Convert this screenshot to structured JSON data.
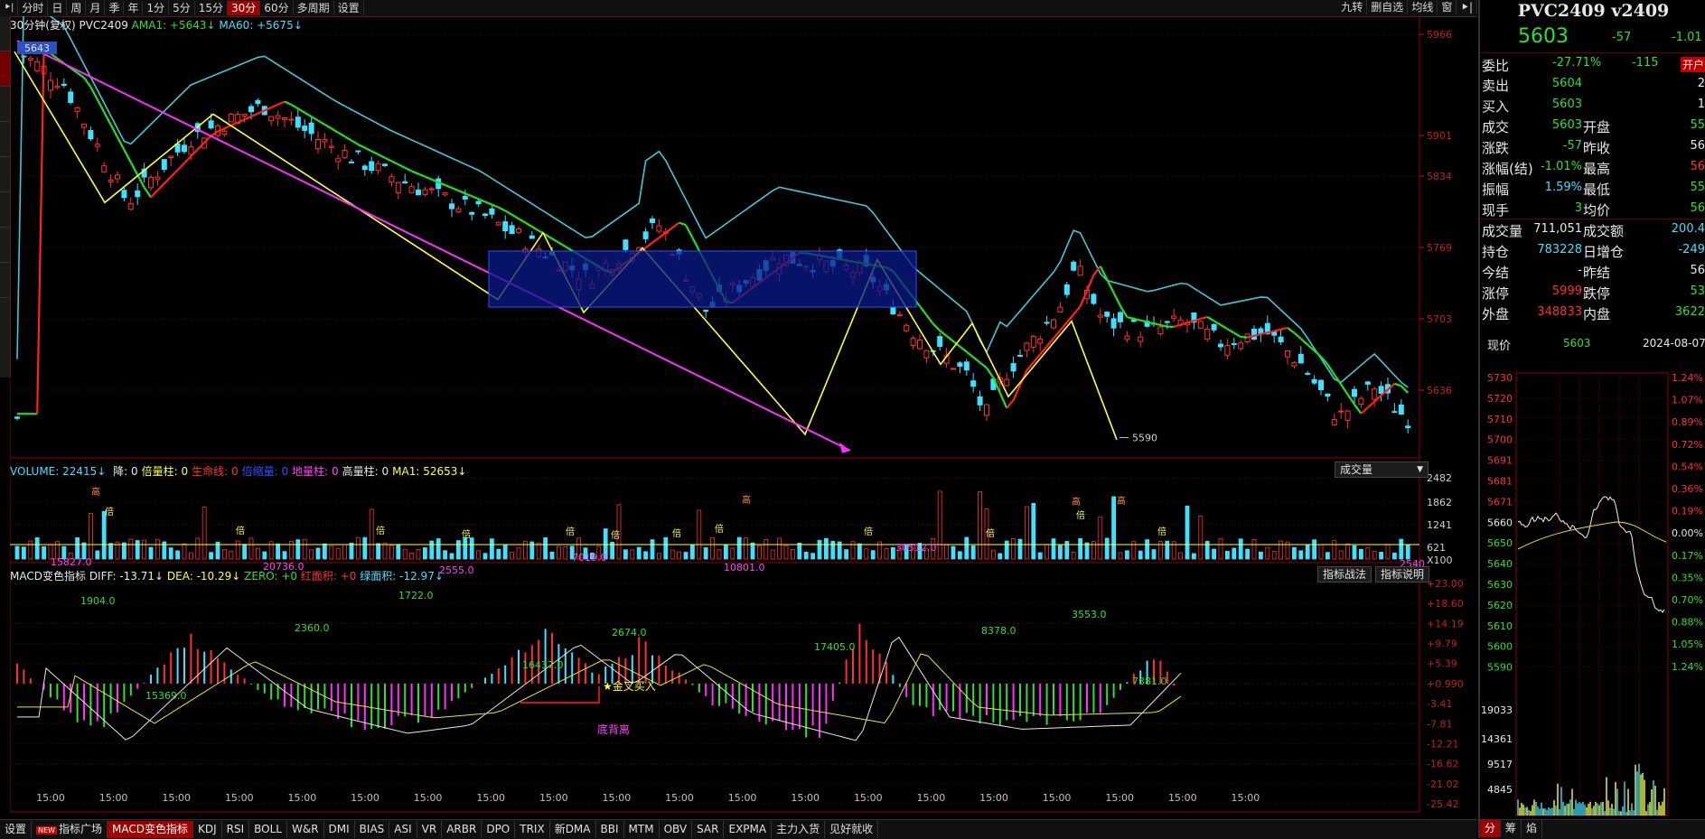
{
  "periods": [
    "分时",
    "日",
    "周",
    "月",
    "季",
    "年",
    "1分",
    "5分",
    "15分",
    "30分",
    "60分",
    "多周期",
    "设置"
  ],
  "active_period": "30分",
  "right_buttons": [
    "九转",
    "删自选",
    "均线",
    "窗"
  ],
  "main_legend": {
    "title": "30分钟(复权)",
    "symbol": "PVC2409",
    "ama": "AMA1: +5643↓",
    "ma": "MA60: +5675↓"
  },
  "price_axis": [
    "5966",
    "5901",
    "5834",
    "5769",
    "5703",
    "5636"
  ],
  "annotations": {
    "top_price": "5643",
    "low_price": "5590"
  },
  "volume_legend": {
    "volume": "VOLUME: 22415↓",
    "items": [
      {
        "label": "降: 0",
        "color": "#e8e8e8"
      },
      {
        "label": "倍量柱: 0",
        "color": "#ffff40"
      },
      {
        "label": "生命线: 0",
        "color": "#ff3030"
      },
      {
        "label": "倍缩量: 0",
        "color": "#3050ff"
      },
      {
        "label": "地量柱: 0",
        "color": "#ff40ff"
      },
      {
        "label": "高量柱: 0",
        "color": "#e8e8e8"
      },
      {
        "label": "MA1: 52653↓",
        "color": "#ffff40"
      }
    ],
    "dropdown": "成交量"
  },
  "volume_axis": [
    "2482",
    "1862",
    "1241",
    "621",
    "X100"
  ],
  "vol_markers": {
    "high": "高",
    "double": "倍"
  },
  "macd_legend": {
    "title": "MACD变色指标",
    "diff": "DIFF: -13.71↓",
    "dea": "DEA: -10.29↓",
    "zero": "ZERO: +0",
    "red_area": "红面积: +0",
    "green_area": "绿面积: -12.97↓"
  },
  "macd_buttons": [
    "指标战法",
    "指标说明"
  ],
  "macd_axis": [
    "+23.00",
    "+18.60",
    "+14.19",
    "+9.79",
    "+5.39",
    "+0.990",
    "-3.41",
    "-7.81",
    "-12.21",
    "-16.62",
    "-21.02",
    "-25.42"
  ],
  "macd_labels": [
    "15827.0",
    "20736.0",
    "2555.0",
    "7019.0",
    "10801.0",
    "30512.0",
    "2540.",
    "1904.0",
    "2360.0",
    "1722.0",
    "2674.0",
    "16437.0",
    "15369.0",
    "17405.0",
    "8378.0",
    "3553.0",
    "7381.0"
  ],
  "macd_signals": {
    "golden_cross": "★金叉买入",
    "divergence": "底背离"
  },
  "time_axis": [
    "15:00",
    "15:00",
    "15:00",
    "15:00",
    "15:00",
    "15:00",
    "15:00",
    "15:00",
    "15:00",
    "15:00",
    "15:00",
    "15:00",
    "15:00",
    "15:00",
    "15:00",
    "15:00",
    "15:00",
    "15:00",
    "15:00",
    "15:00"
  ],
  "bottom_tabs": [
    "设置",
    "指标广场",
    "MACD变色指标",
    "KDJ",
    "RSI",
    "BOLL",
    "W&R",
    "DMI",
    "BIAS",
    "ASI",
    "VR",
    "ARBR",
    "DPO",
    "TRIX",
    "新DMA",
    "BBI",
    "MTM",
    "OBV",
    "SAR",
    "EXPMA",
    "主力入货",
    "见好就收"
  ],
  "bottom_active": "MACD变色指标",
  "new_badge": "NEW",
  "quote": {
    "title": "PVC2409 v2409",
    "price": "5603",
    "change": "-57",
    "change_pct": "-1.01",
    "wb_label": "委比",
    "wb_pct": "-27.71%",
    "wb_val": "-115",
    "open_tag": "开户",
    "rows": [
      {
        "l1": "卖出",
        "v1": "5604",
        "c1": "green",
        "l2": "",
        "v2": "2",
        "c2": "white"
      },
      {
        "l1": "买入",
        "v1": "5603",
        "c1": "green",
        "l2": "",
        "v2": "1",
        "c2": "white"
      },
      {
        "l1": "成交",
        "v1": "5603",
        "c1": "green",
        "l2": "开盘",
        "v2": "55",
        "c2": "green"
      },
      {
        "l1": "涨跌",
        "v1": "-57",
        "c1": "green",
        "l2": "昨收",
        "v2": "56",
        "c2": "white"
      },
      {
        "l1": "涨幅(结)",
        "v1": "-1.01%",
        "c1": "green",
        "l2": "最高",
        "v2": "56",
        "c2": "red"
      },
      {
        "l1": "振幅",
        "v1": "1.59%",
        "c1": "cyan",
        "l2": "最低",
        "v2": "55",
        "c2": "green"
      },
      {
        "l1": "现手",
        "v1": "3",
        "c1": "green",
        "l2": "均价",
        "v2": "56",
        "c2": "green"
      },
      {
        "l1": "成交量",
        "v1": "711,051",
        "c1": "white",
        "l2": "成交额",
        "v2": "200.4",
        "c2": "cyan"
      },
      {
        "l1": "持仓",
        "v1": "783228",
        "c1": "cyan",
        "l2": "日增仓",
        "v2": "-249",
        "c2": "cyan"
      },
      {
        "l1": "今结",
        "v1": "-",
        "c1": "white",
        "l2": "昨结",
        "v2": "56",
        "c2": "white"
      },
      {
        "l1": "涨停",
        "v1": "5999",
        "c1": "red",
        "l2": "跌停",
        "v2": "53",
        "c2": "green"
      },
      {
        "l1": "外盘",
        "v1": "348833",
        "c1": "red",
        "l2": "内盘",
        "v2": "3622",
        "c2": "green"
      }
    ],
    "current_label": "现价",
    "current_value": "5603",
    "date": "2024-08-07",
    "mini_left_axis": [
      "5730",
      "5720",
      "5710",
      "5700",
      "5691",
      "5681",
      "5671",
      "5660",
      "5650",
      "5640",
      "5630",
      "5620",
      "5610",
      "5600",
      "5590"
    ],
    "mini_right_axis": [
      "1.24%",
      "1.07%",
      "0.89%",
      "0.72%",
      "0.54%",
      "0.36%",
      "0.19%",
      "0.00%",
      "0.17%",
      "0.35%",
      "0.70%",
      "0.88%",
      "1.05%",
      "1.24%"
    ],
    "mini_vol_axis": [
      "19033",
      "14361",
      "9517",
      "4845"
    ],
    "bottom_tabs": [
      "分",
      "筹",
      "焰"
    ]
  },
  "chart_data": {
    "type": "candlestick",
    "series": [
      {
        "name": "AMA1",
        "color": "#ffff00"
      },
      {
        "name": "MA60",
        "color": "#40d0e0"
      }
    ],
    "ylim": [
      5590,
      5966
    ]
  }
}
